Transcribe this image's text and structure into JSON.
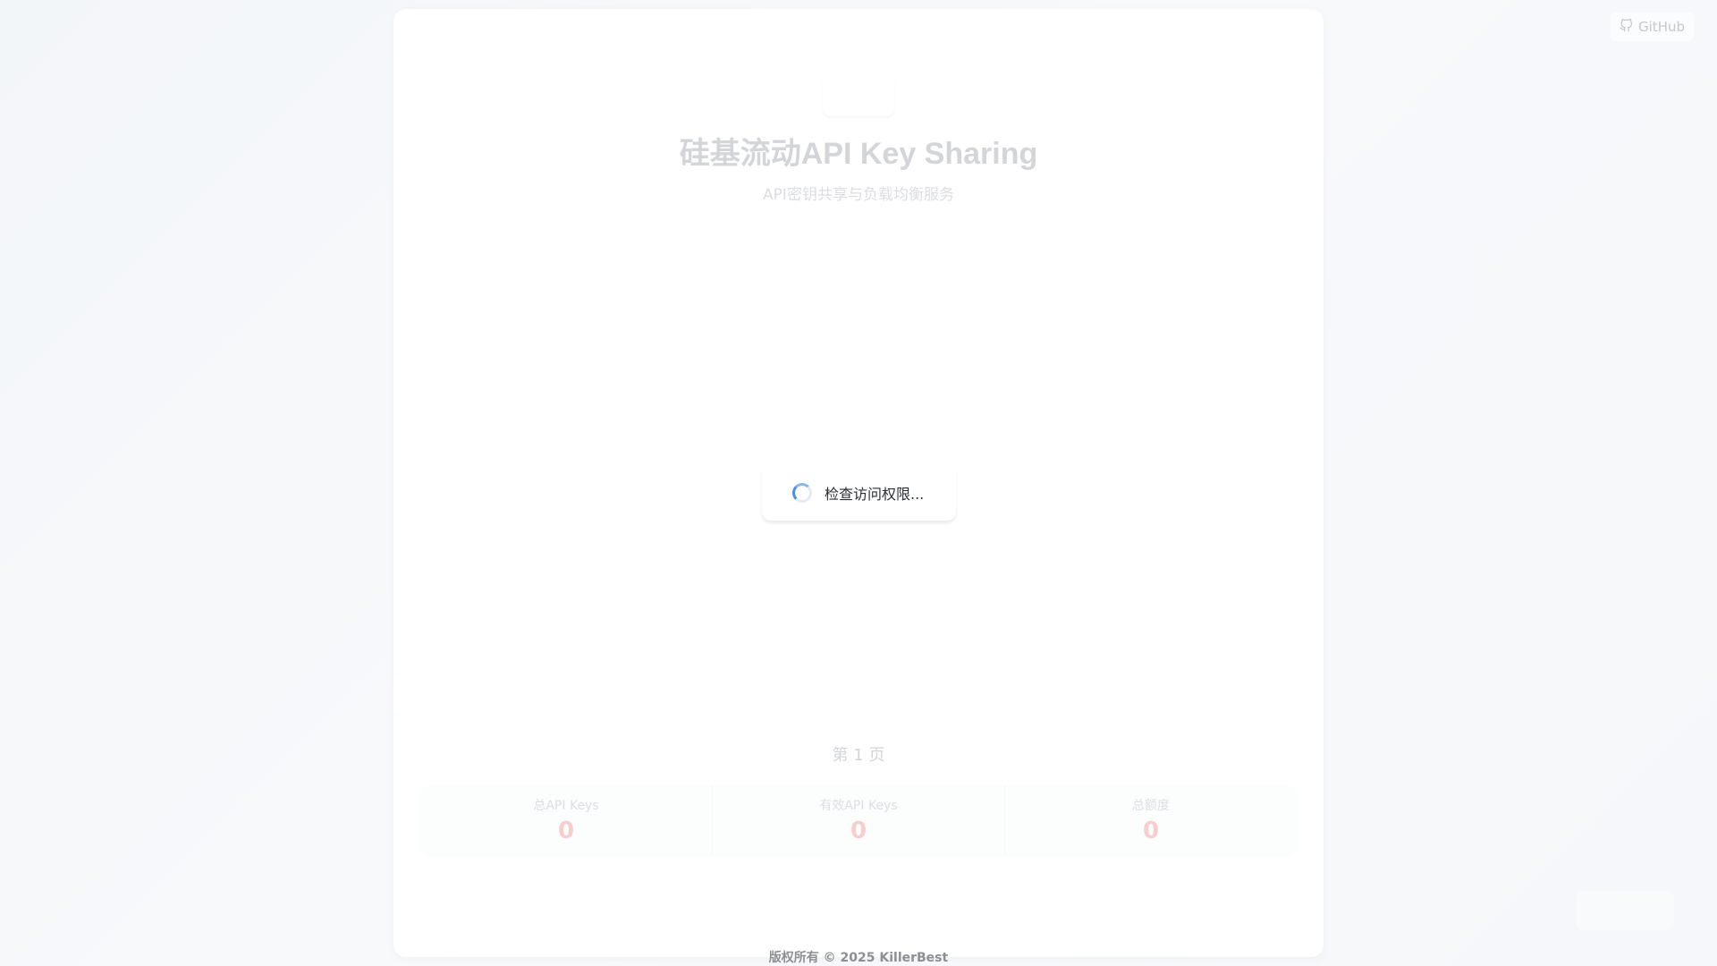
{
  "header": {
    "github_label": "GitHub",
    "github_icon": "github-icon"
  },
  "main": {
    "title": "硅基流动API Key Sharing",
    "subtitle": "API密钥共享与负载均衡服务",
    "loading_text": "检查访问权限...",
    "page_indicator": "第 1 页"
  },
  "stats": [
    {
      "label": "总API Keys",
      "value": "0"
    },
    {
      "label": "有效API Keys",
      "value": "0"
    },
    {
      "label": "总额度",
      "value": "0"
    }
  ],
  "footer": {
    "copyright": "版权所有 © 2025 KillerBest"
  }
}
